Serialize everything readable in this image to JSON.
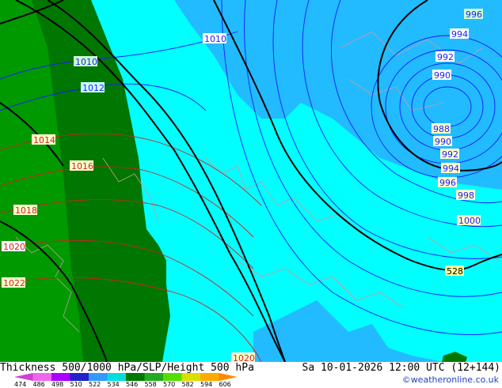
{
  "map": {
    "isobar_labels": [
      {
        "text": "1010",
        "style": "blue"
      },
      {
        "text": "1010",
        "style": "blue"
      },
      {
        "text": "1012",
        "style": "blue"
      },
      {
        "text": "1014",
        "style": "red"
      },
      {
        "text": "1016",
        "style": "red"
      },
      {
        "text": "1018",
        "style": "red"
      },
      {
        "text": "1020",
        "style": "red"
      },
      {
        "text": "1022",
        "style": "red"
      },
      {
        "text": "1020",
        "style": "red"
      },
      {
        "text": "996",
        "style": "blue"
      },
      {
        "text": "994",
        "style": "blue"
      },
      {
        "text": "992",
        "style": "blue"
      },
      {
        "text": "990",
        "style": "blue"
      },
      {
        "text": "988",
        "style": "blue"
      },
      {
        "text": "990",
        "style": "blue"
      },
      {
        "text": "992",
        "style": "blue"
      },
      {
        "text": "994",
        "style": "blue"
      },
      {
        "text": "996",
        "style": "blue"
      },
      {
        "text": "998",
        "style": "blue"
      },
      {
        "text": "1000",
        "style": "blue"
      },
      {
        "text": "528",
        "style": "black"
      }
    ],
    "colors": {
      "thickness_light": "#00ffff",
      "thickness_mid": "#22bbff",
      "thickness_green_dark": "#007700",
      "thickness_green": "#009900",
      "isobar_blue": "#1a1aff",
      "isobar_red": "#cc2222",
      "height_contour": "#000000",
      "coast": "#cc9999"
    }
  },
  "footer": {
    "title": "Thickness 500/1000 hPa/SLP/Height 500 hPa",
    "datetime": "Sa 10-01-2026 12:00 UTC (12+144)",
    "credit": "©weatheronline.co.uk",
    "legend": {
      "ticks": [
        "474",
        "486",
        "498",
        "510",
        "522",
        "534",
        "546",
        "558",
        "570",
        "582",
        "594",
        "606"
      ],
      "colors": [
        "#cc44cc",
        "#ee66ee",
        "#aa00ff",
        "#2222cc",
        "#3399ff",
        "#00dddd",
        "#007700",
        "#22aa22",
        "#55dd00",
        "#dddd00",
        "#ffaa00",
        "#ff8800"
      ]
    }
  }
}
